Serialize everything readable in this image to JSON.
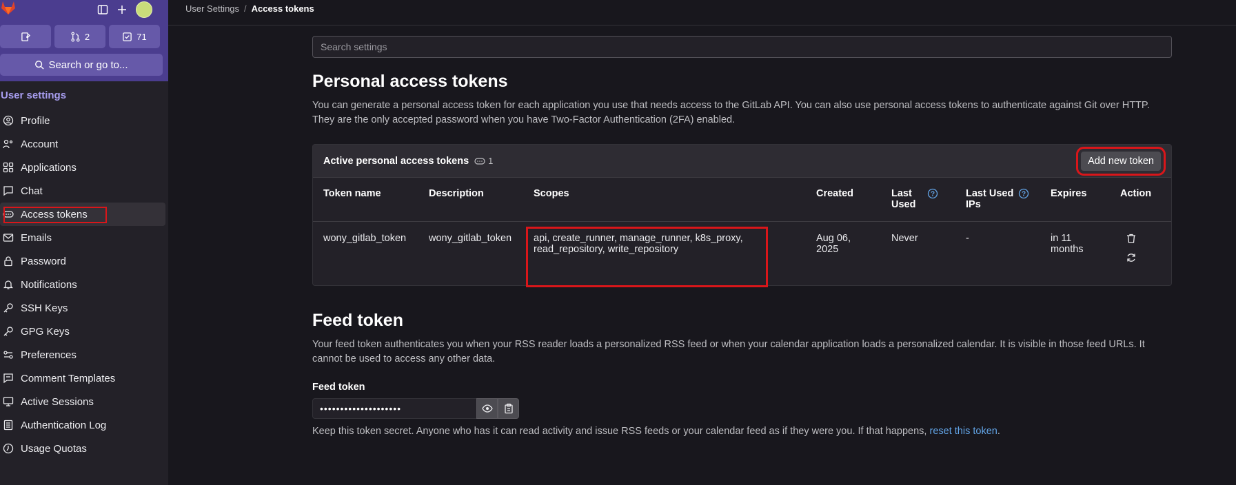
{
  "sidebar": {
    "counts": {
      "merge_requests": "2",
      "todos": "71"
    },
    "search_label": "Search or go to...",
    "section_title": "User settings",
    "items": [
      {
        "label": "Profile",
        "icon": "profile-icon"
      },
      {
        "label": "Account",
        "icon": "account-icon"
      },
      {
        "label": "Applications",
        "icon": "applications-icon"
      },
      {
        "label": "Chat",
        "icon": "chat-icon"
      },
      {
        "label": "Access tokens",
        "icon": "token-icon"
      },
      {
        "label": "Emails",
        "icon": "mail-icon"
      },
      {
        "label": "Password",
        "icon": "lock-icon"
      },
      {
        "label": "Notifications",
        "icon": "bell-icon"
      },
      {
        "label": "SSH Keys",
        "icon": "key-icon"
      },
      {
        "label": "GPG Keys",
        "icon": "key-icon"
      },
      {
        "label": "Preferences",
        "icon": "preferences-icon"
      },
      {
        "label": "Comment Templates",
        "icon": "comment-icon"
      },
      {
        "label": "Active Sessions",
        "icon": "monitor-icon"
      },
      {
        "label": "Authentication Log",
        "icon": "log-icon"
      },
      {
        "label": "Usage Quotas",
        "icon": "quota-icon"
      }
    ]
  },
  "breadcrumb": {
    "parent": "User Settings",
    "separator": "/",
    "current": "Access tokens"
  },
  "search": {
    "placeholder": "Search settings"
  },
  "pat": {
    "title": "Personal access tokens",
    "description": "You can generate a personal access token for each application you use that needs access to the GitLab API. You can also use personal access tokens to authenticate against Git over HTTP. They are the only accepted password when you have Two-Factor Authentication (2FA) enabled.",
    "card_title": "Active personal access tokens",
    "card_count": "1",
    "add_button": "Add new token",
    "columns": [
      "Token name",
      "Description",
      "Scopes",
      "Created",
      "Last Used",
      "Last Used IPs",
      "Expires",
      "Action"
    ],
    "rows": [
      {
        "name": "wony_gitlab_token",
        "description": "wony_gitlab_token",
        "scopes": "api, create_runner, manage_runner, k8s_proxy, read_repository, write_repository",
        "created": "Aug 06, 2025",
        "last_used": "Never",
        "last_ips": "-",
        "expires": "in 11 months"
      }
    ]
  },
  "feed": {
    "title": "Feed token",
    "description": "Your feed token authenticates you when your RSS reader loads a personalized RSS feed or when your calendar application loads a personalized calendar. It is visible in those feed URLs. It cannot be used to access any other data.",
    "label": "Feed token",
    "value": "••••••••••••••••••••",
    "note_prefix": "Keep this token secret. Anyone who has it can read activity and issue RSS feeds or your calendar feed as if they were you. If that happens, ",
    "note_link": "reset this token",
    "note_suffix": "."
  },
  "colors": {
    "accent_purple": "#4b3d8f",
    "highlight_red": "#d9161a",
    "link": "#63a6e9"
  }
}
